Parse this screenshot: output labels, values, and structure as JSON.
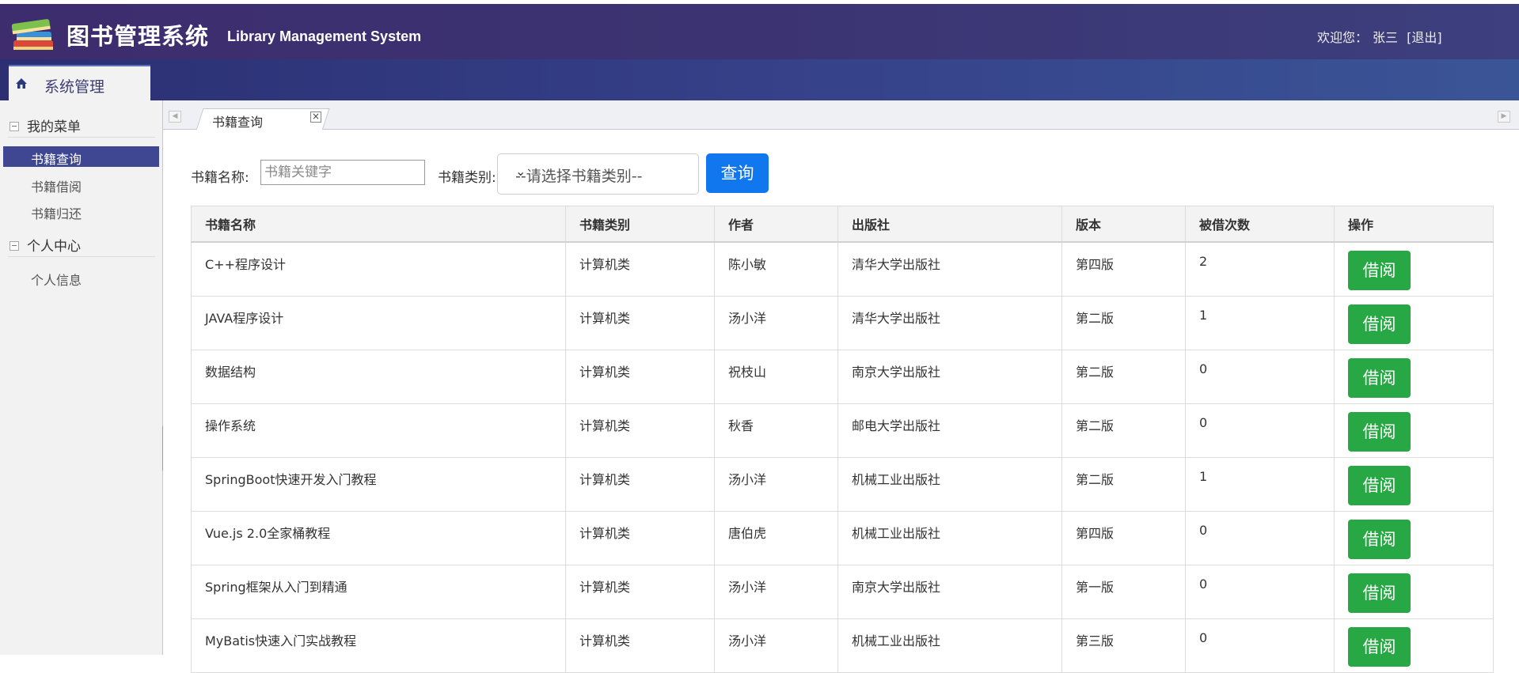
{
  "header": {
    "title_cn": "图书管理系统",
    "title_en": "Library Management System",
    "welcome_label": "欢迎您：",
    "user_name": "张三",
    "logout": "[退出]"
  },
  "nav": {
    "tab_label": "系统管理"
  },
  "sidebar": {
    "groups": [
      {
        "label": "我的菜单",
        "items": [
          "书籍查询",
          "书籍借阅",
          "书籍归还"
        ]
      },
      {
        "label": "个人中心",
        "items": [
          "个人信息"
        ]
      }
    ],
    "active_item": "书籍查询"
  },
  "tabs": {
    "active_tab": "书籍查询",
    "close_glyph": "×"
  },
  "search": {
    "name_label": "书籍名称:",
    "name_placeholder": "书籍关键字",
    "category_label": "书籍类别:",
    "category_selected": "--请选择书籍类别--",
    "query_button": "查询"
  },
  "table": {
    "columns": [
      "书籍名称",
      "书籍类别",
      "作者",
      "出版社",
      "版本",
      "被借次数",
      "操作"
    ],
    "action_label": "借阅",
    "rows": [
      {
        "name": "C++程序设计",
        "category": "计算机类",
        "author": "陈小敏",
        "publisher": "清华大学出版社",
        "edition": "第四版",
        "count": "2"
      },
      {
        "name": "JAVA程序设计",
        "category": "计算机类",
        "author": "汤小洋",
        "publisher": "清华大学出版社",
        "edition": "第二版",
        "count": "1"
      },
      {
        "name": "数据结构",
        "category": "计算机类",
        "author": "祝枝山",
        "publisher": "南京大学出版社",
        "edition": "第二版",
        "count": "0"
      },
      {
        "name": "操作系统",
        "category": "计算机类",
        "author": "秋香",
        "publisher": "邮电大学出版社",
        "edition": "第二版",
        "count": "0"
      },
      {
        "name": "SpringBoot快速开发入门教程",
        "category": "计算机类",
        "author": "汤小洋",
        "publisher": "机械工业出版社",
        "edition": "第二版",
        "count": "1"
      },
      {
        "name": "Vue.js 2.0全家桶教程",
        "category": "计算机类",
        "author": "唐伯虎",
        "publisher": "机械工业出版社",
        "edition": "第四版",
        "count": "0"
      },
      {
        "name": "Spring框架从入门到精通",
        "category": "计算机类",
        "author": "汤小洋",
        "publisher": "南京大学出版社",
        "edition": "第一版",
        "count": "0"
      },
      {
        "name": "MyBatis快速入门实战教程",
        "category": "计算机类",
        "author": "汤小洋",
        "publisher": "机械工业出版社",
        "edition": "第三版",
        "count": "0"
      }
    ]
  },
  "colors": {
    "header_bg": "#3d2c6e",
    "nav_bg": "#36428a",
    "active_item_bg": "#3f4793",
    "query_button_bg": "#1177ee",
    "borrow_button_bg": "#28a745"
  },
  "icons": [
    "books-logo-icon",
    "home-icon",
    "collapse-toggle-icon",
    "close-icon",
    "chevron-down-icon",
    "scroll-left-icon",
    "scroll-right-icon"
  ]
}
